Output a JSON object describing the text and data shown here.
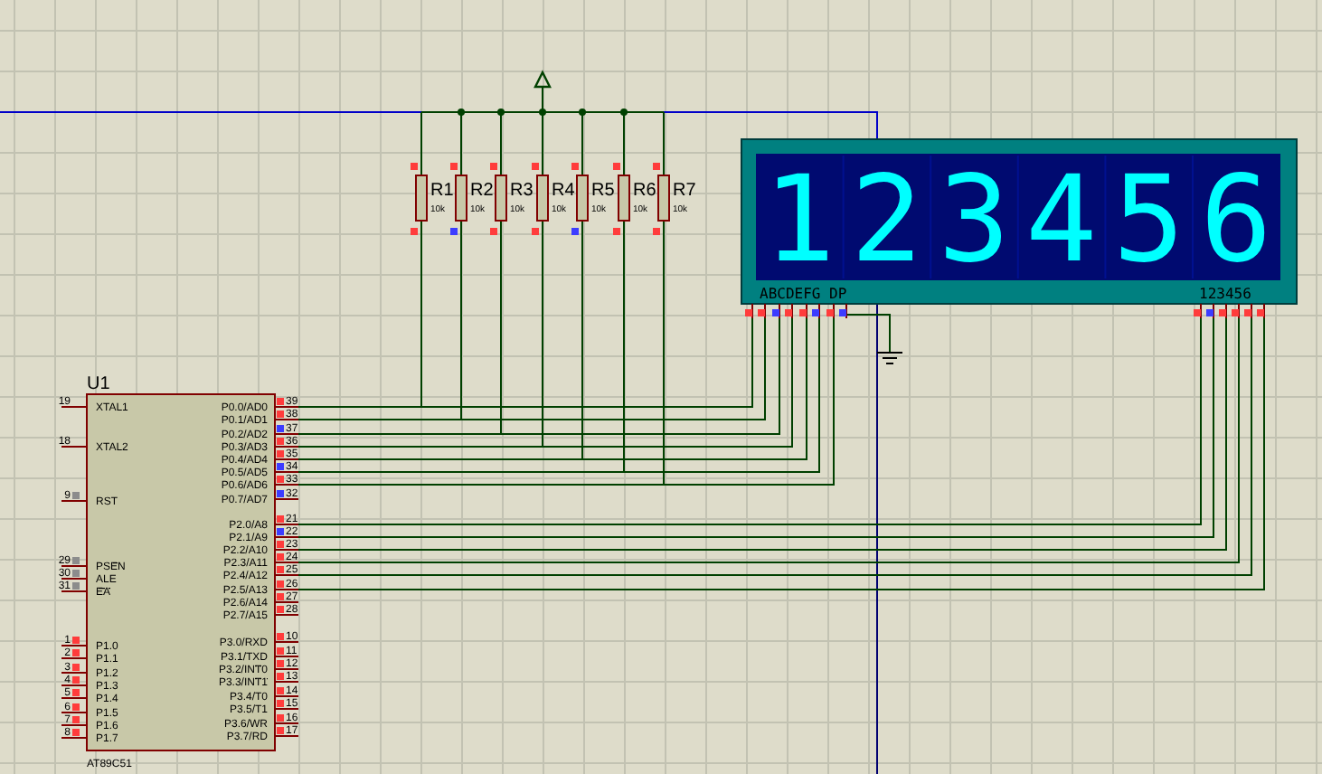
{
  "chip": {
    "reference": "U1",
    "part": "AT89C51",
    "left_pins": [
      {
        "number": "19",
        "label": "XTAL1"
      },
      {
        "number": "18",
        "label": "XTAL2"
      },
      {
        "number": "9",
        "label": "RST",
        "color": "#8c8c8c"
      },
      {
        "number": "29",
        "overlined": "PSEN",
        "color": "#8c8c8c"
      },
      {
        "number": "30",
        "label": "ALE",
        "color": "#8c8c8c"
      },
      {
        "number": "31",
        "overlined": "EA",
        "color": "#8c8c8c"
      },
      {
        "number": "1",
        "label": "P1.0",
        "color": "#ff3c3c"
      },
      {
        "number": "2",
        "label": "P1.1",
        "color": "#ff3c3c"
      },
      {
        "number": "3",
        "label": "P1.2",
        "color": "#ff3c3c"
      },
      {
        "number": "4",
        "label": "P1.3",
        "color": "#ff3c3c"
      },
      {
        "number": "5",
        "label": "P1.4",
        "color": "#ff3c3c"
      },
      {
        "number": "6",
        "label": "P1.5",
        "color": "#ff3c3c"
      },
      {
        "number": "7",
        "label": "P1.6",
        "color": "#ff3c3c"
      },
      {
        "number": "8",
        "label": "P1.7",
        "color": "#ff3c3c"
      }
    ],
    "right_pins": [
      {
        "number": "39",
        "label": "P0.0/AD0",
        "color": "#ff3c3c"
      },
      {
        "number": "38",
        "label": "P0.1/AD1",
        "color": "#ff3c3c"
      },
      {
        "number": "37",
        "label": "P0.2/AD2",
        "color": "#3c3cff"
      },
      {
        "number": "36",
        "label": "P0.3/AD3",
        "color": "#ff3c3c"
      },
      {
        "number": "35",
        "label": "P0.4/AD4",
        "color": "#ff3c3c"
      },
      {
        "number": "34",
        "label": "P0.5/AD5",
        "color": "#3c3cff"
      },
      {
        "number": "33",
        "label": "P0.6/AD6",
        "color": "#ff3c3c"
      },
      {
        "number": "32",
        "label": "P0.7/AD7",
        "color": "#3c3cff"
      },
      {
        "number": "21",
        "label": "P2.0/A8",
        "color": "#ff3c3c"
      },
      {
        "number": "22",
        "label": "P2.1/A9",
        "color": "#3c3cff"
      },
      {
        "number": "23",
        "label": "P2.2/A10",
        "color": "#ff3c3c"
      },
      {
        "number": "24",
        "label": "P2.3/A11",
        "color": "#ff3c3c"
      },
      {
        "number": "25",
        "label": "P2.4/A12",
        "color": "#ff3c3c"
      },
      {
        "number": "26",
        "label": "P2.5/A13",
        "color": "#ff3c3c"
      },
      {
        "number": "27",
        "label": "P2.6/A14",
        "color": "#ff3c3c"
      },
      {
        "number": "28",
        "label": "P2.7/A15",
        "color": "#ff3c3c"
      },
      {
        "number": "10",
        "label": "P3.0/RXD",
        "color": "#ff3c3c"
      },
      {
        "number": "11",
        "label": "P3.1/TXD",
        "color": "#ff3c3c"
      },
      {
        "number": "12",
        "label": "P3.2/",
        "overlined": "INT0",
        "color": "#ff3c3c"
      },
      {
        "number": "13",
        "label": "P3.3/",
        "overlined": "INT1",
        "color": "#ff3c3c"
      },
      {
        "number": "14",
        "label": "P3.4/T0",
        "color": "#ff3c3c"
      },
      {
        "number": "15",
        "label": "P3.5/T1",
        "color": "#ff3c3c"
      },
      {
        "number": "16",
        "label": "P3.6/",
        "overlined": "WR",
        "color": "#ff3c3c"
      },
      {
        "number": "17",
        "label": "P3.7/",
        "overlined": "RD",
        "color": "#ff3c3c"
      }
    ]
  },
  "resistors": [
    {
      "reference": "R1",
      "value": "10k",
      "top_pin": {
        "color": "#ff3c3c"
      },
      "bottom_pin": {
        "color": "#ff3c3c"
      }
    },
    {
      "reference": "R2",
      "value": "10k",
      "top_pin": {
        "color": "#ff3c3c"
      },
      "bottom_pin": {
        "color": "#3c3cff"
      }
    },
    {
      "reference": "R3",
      "value": "10k",
      "top_pin": {
        "color": "#ff3c3c"
      },
      "bottom_pin": {
        "color": "#ff3c3c"
      }
    },
    {
      "reference": "R4",
      "value": "10k",
      "top_pin": {
        "color": "#ff3c3c"
      },
      "bottom_pin": {
        "color": "#ff3c3c"
      }
    },
    {
      "reference": "R5",
      "value": "10k",
      "top_pin": {
        "color": "#ff3c3c"
      },
      "bottom_pin": {
        "color": "#3c3cff"
      }
    },
    {
      "reference": "R6",
      "value": "10k",
      "top_pin": {
        "color": "#ff3c3c"
      },
      "bottom_pin": {
        "color": "#ff3c3c"
      }
    },
    {
      "reference": "R7",
      "value": "10k",
      "top_pin": {
        "color": "#ff3c3c"
      },
      "bottom_pin": {
        "color": "#ff3c3c"
      }
    }
  ],
  "display": {
    "digits": [
      "1",
      "2",
      "3",
      "4",
      "5",
      "6"
    ],
    "segment_label": "ABCDEFG DP",
    "digit_label": "123456",
    "segment_pins": [
      {
        "color": "#ff3c3c"
      },
      {
        "color": "#ff3c3c"
      },
      {
        "color": "#3c3cff"
      },
      {
        "color": "#ff3c3c"
      },
      {
        "color": "#ff3c3c"
      },
      {
        "color": "#3c3cff"
      },
      {
        "color": "#ff3c3c"
      },
      {
        "color": "#3c3cff"
      }
    ],
    "digit_pins": [
      {
        "color": "#ff3c3c"
      },
      {
        "color": "#3c3cff"
      },
      {
        "color": "#ff3c3c"
      },
      {
        "color": "#ff3c3c"
      },
      {
        "color": "#ff3c3c"
      },
      {
        "color": "#ff3c3c"
      }
    ]
  }
}
